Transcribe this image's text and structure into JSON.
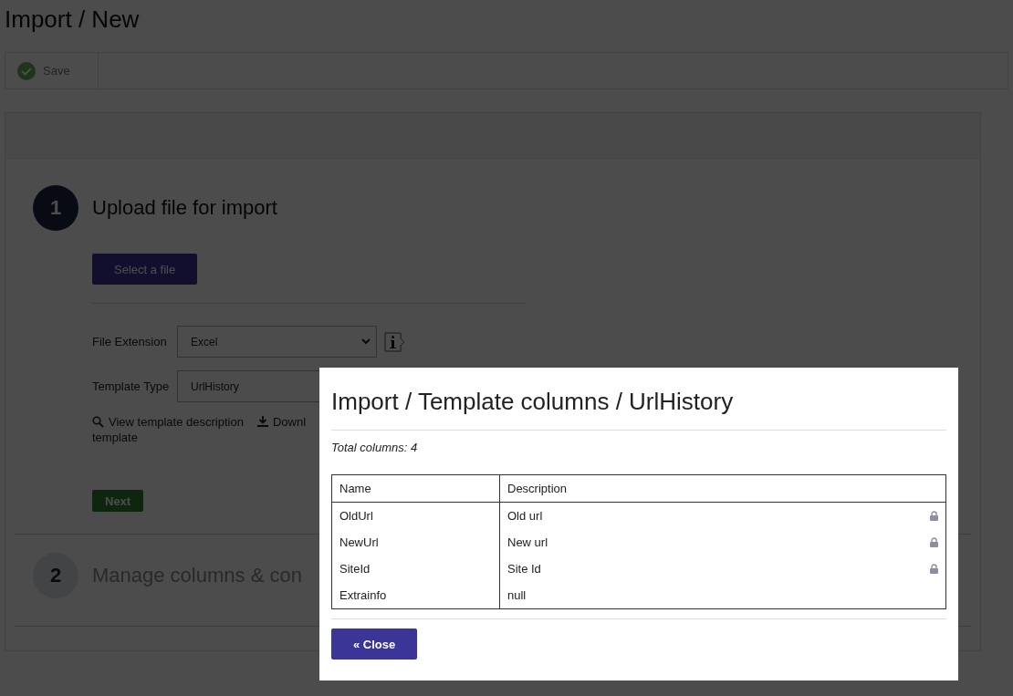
{
  "page_title": "Import / New",
  "toolbar": {
    "buttons": [
      {
        "label": "Save",
        "kind": "save"
      }
    ]
  },
  "steps": [
    {
      "number": "1",
      "title": "Upload file for import",
      "active": true
    },
    {
      "number": "2",
      "title": "Manage columns & con",
      "active": false
    }
  ],
  "upload": {
    "select_button": "Select a file",
    "fields": [
      {
        "label": "File Extension",
        "value": "Excel",
        "kind": "dropdown"
      },
      {
        "label": "Template Type",
        "value": "UrlHistory",
        "kind": "text"
      }
    ],
    "links": [
      {
        "label": "View template description",
        "kind": "search"
      },
      {
        "label": "Downl",
        "kind": "download"
      }
    ],
    "wrapped_text": "template",
    "next_button": {
      "label": "Next",
      "disabled": true
    }
  },
  "modal": {
    "title": "Import / Template columns / UrlHistory",
    "summary": "Total columns: 4",
    "columns": [
      "Name",
      "Description"
    ],
    "rows": [
      {
        "name": "OldUrl",
        "description": "Old url",
        "locked": true
      },
      {
        "name": "NewUrl",
        "description": "New url",
        "locked": true
      },
      {
        "name": "SiteId",
        "description": "Site Id",
        "locked": true
      },
      {
        "name": "Extrainfo",
        "description": "null",
        "locked": false
      }
    ],
    "close_button": "« Close"
  }
}
